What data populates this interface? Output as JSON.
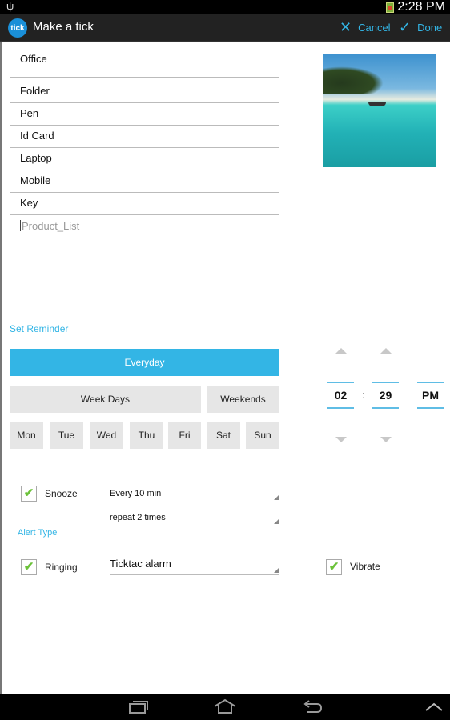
{
  "status_bar": {
    "usb_icon": "usb-icon",
    "battery_icon": "battery-icon",
    "time": "2:28 PM"
  },
  "action_bar": {
    "logo_text": "tick",
    "title": "Make a tick",
    "cancel_label": "Cancel",
    "done_label": "Done",
    "cancel_icon": "✕",
    "done_icon": "✓"
  },
  "list": {
    "title": "Office",
    "items": [
      "Folder",
      "Pen",
      "Id Card",
      "Laptop",
      "Mobile",
      "Key"
    ],
    "new_item_placeholder": "Product_List"
  },
  "reminder": {
    "section_label": "Set Reminder",
    "everyday_label": "Everyday",
    "weekdays_label": "Week Days",
    "weekends_label": "Weekends",
    "days": [
      "Mon",
      "Tue",
      "Wed",
      "Thu",
      "Fri",
      "Sat",
      "Sun"
    ],
    "selected": "Everyday",
    "time": {
      "hour": "02",
      "separator": ":",
      "minute": "29",
      "ampm": "PM"
    }
  },
  "snooze": {
    "label": "Snooze",
    "checked": true,
    "interval": "Every 10 min",
    "repeat": "repeat 2 times"
  },
  "alert": {
    "section_label": "Alert Type",
    "ringing_label": "Ringing",
    "ringing_checked": true,
    "ringtone": "Ticktac alarm",
    "vibrate_label": "Vibrate",
    "vibrate_checked": true
  },
  "check_glyph": "✔",
  "colors": {
    "accent": "#33b5e5",
    "check": "#6cc23a",
    "button_bg": "#e6e6e6",
    "action_bar": "#222222"
  }
}
